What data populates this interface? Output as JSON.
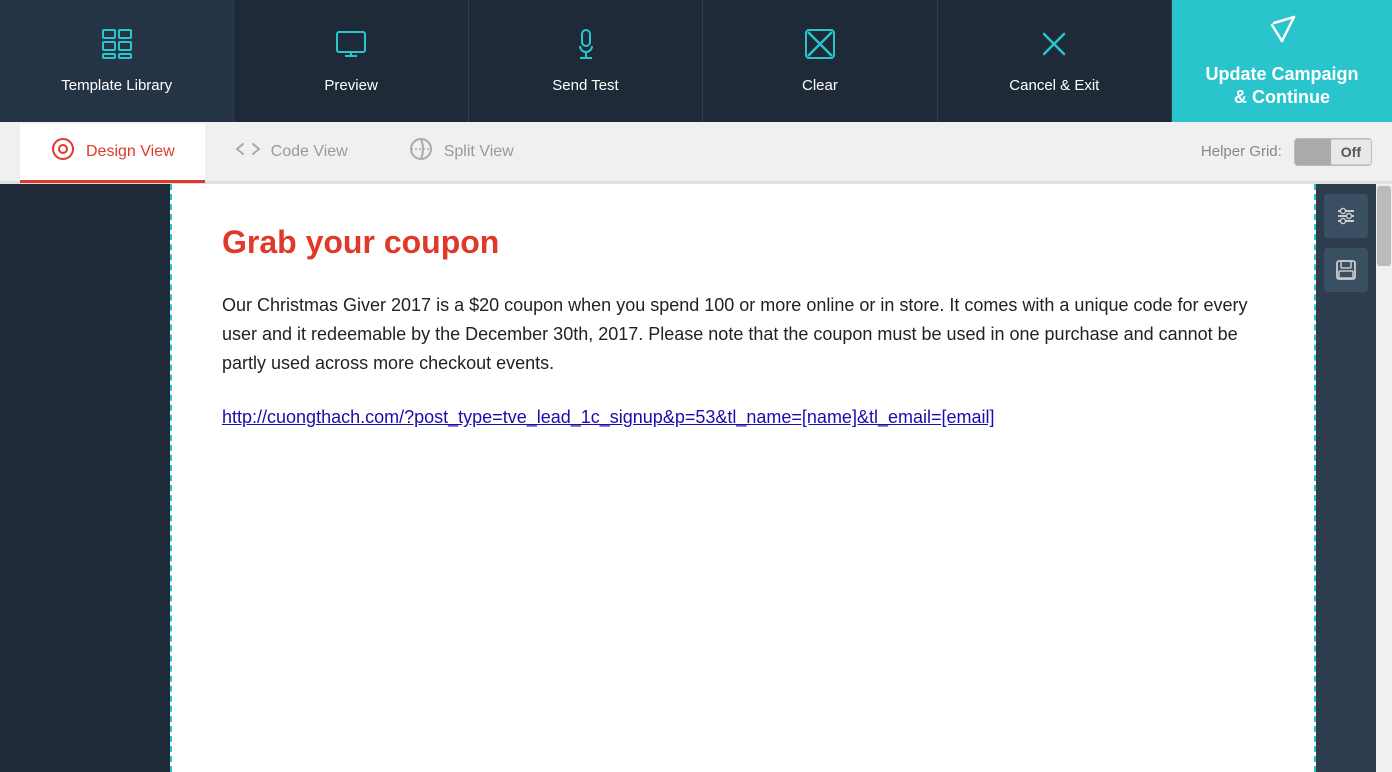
{
  "toolbar": {
    "items": [
      {
        "id": "template-library",
        "label": "Template Library",
        "icon": "grid"
      },
      {
        "id": "preview",
        "label": "Preview",
        "icon": "monitor"
      },
      {
        "id": "send-test",
        "label": "Send Test",
        "icon": "flask"
      },
      {
        "id": "clear",
        "label": "Clear",
        "icon": "clear-x"
      },
      {
        "id": "cancel-exit",
        "label": "Cancel & Exit",
        "icon": "cancel-x"
      }
    ],
    "update_label_line1": "Update Campaign",
    "update_label_line2": "& Continue"
  },
  "view_tabs": {
    "tabs": [
      {
        "id": "design-view",
        "label": "Design View",
        "active": true
      },
      {
        "id": "code-view",
        "label": "Code View",
        "active": false
      },
      {
        "id": "split-view",
        "label": "Split View",
        "active": false
      }
    ],
    "helper_grid_label": "Helper Grid:",
    "toggle_label": "Off"
  },
  "canvas": {
    "title": "Grab your coupon",
    "body": "Our Christmas Giver 2017 is a $20 coupon when you spend 100 or more online or in store. It comes with a unique code for every user and it redeemable by the December 30th, 2017. Please note that the coupon must be used in one purchase and cannot be partly used across more checkout events.",
    "link": "http://cuongthach.com/?post_type=tve_lead_1c_signup&p=53&tl_name=[name]&tl_email=[email]"
  }
}
